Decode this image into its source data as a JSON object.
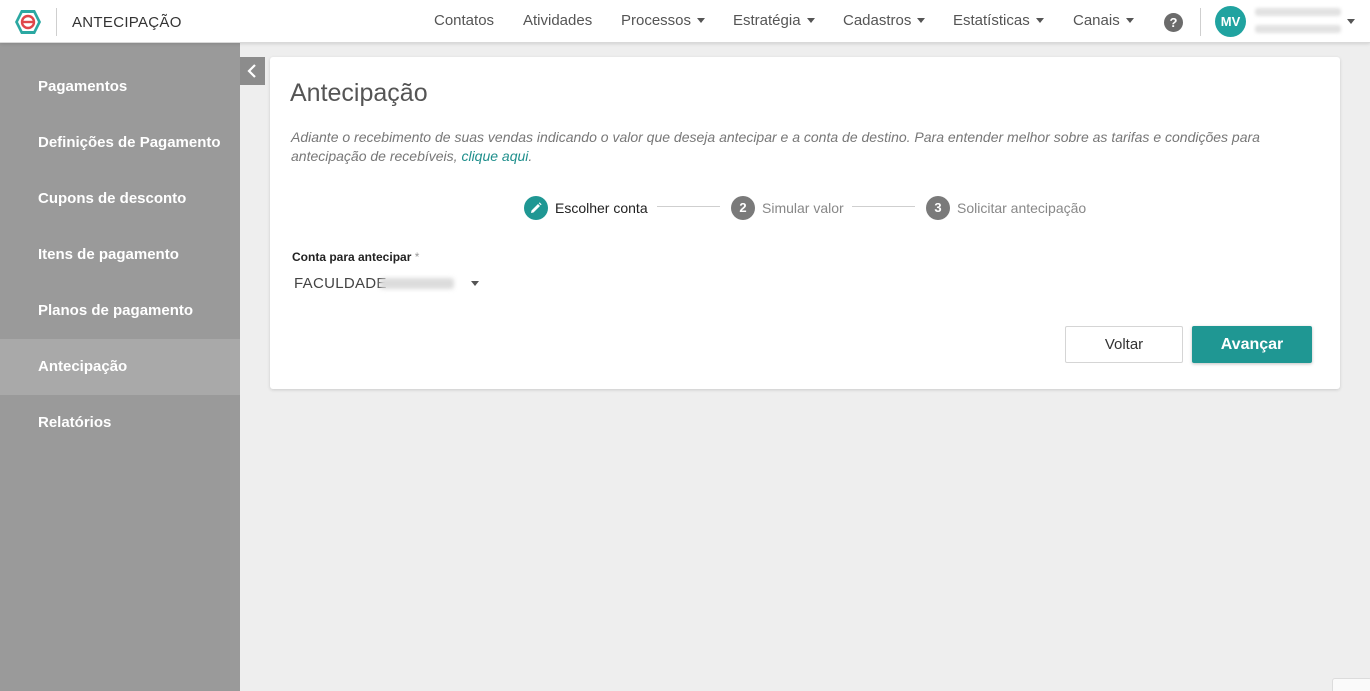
{
  "header": {
    "app_title": "ANTECIPAÇÃO",
    "nav": [
      {
        "label": "Contatos",
        "dropdown": false
      },
      {
        "label": "Atividades",
        "dropdown": false
      },
      {
        "label": "Processos",
        "dropdown": true
      },
      {
        "label": "Estratégia",
        "dropdown": true
      },
      {
        "label": "Cadastros",
        "dropdown": true
      },
      {
        "label": "Estatísticas",
        "dropdown": true
      },
      {
        "label": "Canais",
        "dropdown": true
      }
    ],
    "help_icon": "?",
    "user": {
      "initials": "MV"
    }
  },
  "sidebar": {
    "items": [
      {
        "label": "Pagamentos",
        "active": false
      },
      {
        "label": "Definições de Pagamento",
        "active": false
      },
      {
        "label": "Cupons de desconto",
        "active": false
      },
      {
        "label": "Itens de pagamento",
        "active": false
      },
      {
        "label": "Planos de pagamento",
        "active": false
      },
      {
        "label": "Antecipação",
        "active": true
      },
      {
        "label": "Relatórios",
        "active": false
      }
    ],
    "collapse_icon": "chevron-left-icon"
  },
  "card": {
    "title": "Antecipação",
    "description_prefix": "Adiante o recebimento de suas vendas indicando o valor que deseja antecipar e a conta de destino. Para entender melhor sobre as tarifas e condições para antecipação de recebíveis, ",
    "description_link": "clique aqui",
    "description_suffix": ".",
    "steps": [
      {
        "number": "1",
        "label": "Escolher conta",
        "active": true,
        "icon": "pencil-icon"
      },
      {
        "number": "2",
        "label": "Simular valor",
        "active": false
      },
      {
        "number": "3",
        "label": "Solicitar antecipação",
        "active": false
      }
    ],
    "field_label": "Conta para antecipar",
    "field_required_mark": "*",
    "field_value": "FACULDADE",
    "back_label": "Voltar",
    "next_label": "Avançar"
  },
  "colors": {
    "accent": "#1f9793",
    "sidebar_bg": "#9a9a9a",
    "sidebar_active": "#a9a9a9"
  }
}
